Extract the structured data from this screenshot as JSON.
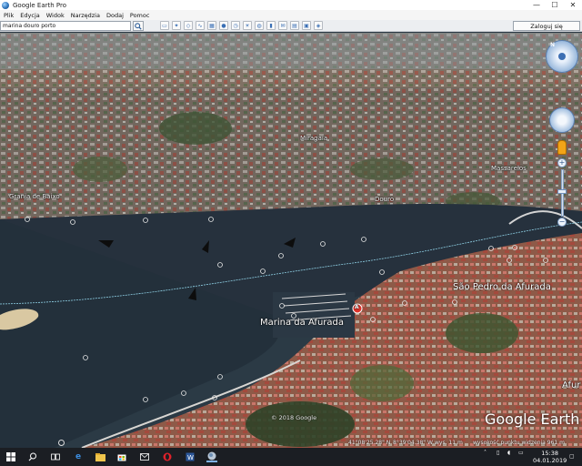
{
  "window": {
    "title": "Google Earth Pro",
    "controls": {
      "minimize": "—",
      "maximize": "☐",
      "close": "✕"
    }
  },
  "menu": [
    "Plik",
    "Edycja",
    "Widok",
    "Narzędzia",
    "Dodaj",
    "Pomoc"
  ],
  "toolbar": {
    "search_value": "marina douro porto",
    "search_icon": "magnifier-icon",
    "signin_label": "Zaloguj się",
    "icons": [
      "sidebar-icon",
      "placemark-icon",
      "polygon-icon",
      "path-icon",
      "overlay-icon",
      "record-tour-icon",
      "history-icon",
      "sun-icon",
      "planets-icon",
      "ruler-icon",
      "email-icon",
      "print-icon",
      "save-image-icon",
      "maps-icon"
    ]
  },
  "map": {
    "places": [
      {
        "name": "Granja de Baixo",
        "size": "small"
      },
      {
        "name": "Miragaia",
        "size": "small"
      },
      {
        "name": "Massarelos",
        "size": "small"
      },
      {
        "name": "Douro",
        "size": "small"
      },
      {
        "name": "São Pedro da Afurada",
        "size": "big"
      },
      {
        "name": "Marina da Afurada",
        "size": "big"
      },
      {
        "name": "Afur",
        "size": "big"
      }
    ],
    "marker_label": "A",
    "navigation": {
      "north_label": "N",
      "zoom_in": "+",
      "zoom_out": "−"
    }
  },
  "overlay": {
    "copyright": "© 2018 Google",
    "brand": "Google Earth"
  },
  "status": {
    "lat": "41°08'25.28\" N",
    "lon": "8°39'04.38\" W",
    "elev": "wys.   11 m",
    "eye": "wysokość punktu widzenia  961 m"
  },
  "taskbar": {
    "time": "15:38",
    "date": "04.01.2019"
  },
  "colors": {
    "water": "#26313d",
    "city": "#8a7a6e",
    "accent": "#3d6fb3"
  }
}
